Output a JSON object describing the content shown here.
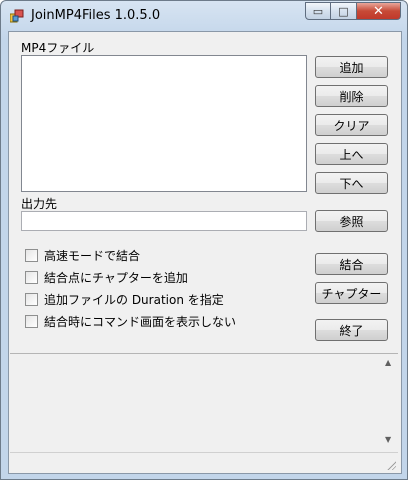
{
  "window": {
    "title": "JoinMP4Files 1.0.5.0"
  },
  "title_controls": {
    "minimize": "▭",
    "maximize": "□",
    "close": "✕"
  },
  "mp4_label": "MP4ファイル",
  "output_label": "出力先",
  "buttons": {
    "add": "追加",
    "delete": "削除",
    "clear": "クリア",
    "up": "上へ",
    "down": "下へ",
    "browse": "参照",
    "join": "結合",
    "chapter": "チャプター",
    "exit": "終了"
  },
  "checkboxes": [
    {
      "label": "高速モードで結合",
      "checked": false
    },
    {
      "label": "結合点にチャプターを追加",
      "checked": false
    },
    {
      "label": "追加ファイルの Duration を指定",
      "checked": false
    },
    {
      "label": "結合時にコマンド画面を表示しない",
      "checked": false
    }
  ],
  "output_path": "",
  "scroll": {
    "up": "▲",
    "down": "▼"
  },
  "icons": {
    "app": "app-icon",
    "scroll_up": "scroll-up-icon",
    "scroll_down": "scroll-down-icon"
  }
}
